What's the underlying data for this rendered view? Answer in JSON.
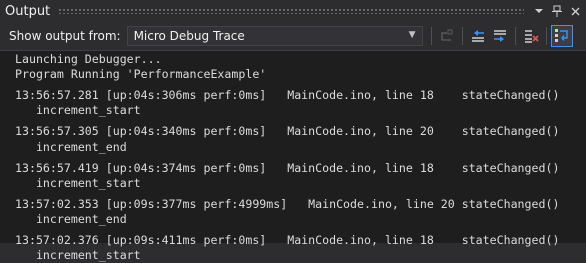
{
  "window": {
    "title": "Output"
  },
  "toolbar": {
    "show_output_label": "Show output from:",
    "source_selected": "Micro Debug Trace"
  },
  "icons": {
    "dropdown": "chevron-down-icon",
    "pin": "pin-icon",
    "close": "close-icon",
    "find_message": "find-message-icon",
    "previous_message": "previous-message-icon",
    "next_message": "next-message-icon",
    "clear_all": "clear-all-icon",
    "word_wrap": "word-wrap-icon"
  },
  "colors": {
    "accent": "#3794ff",
    "clear_red": "#e05252",
    "background": "#1e1e1e",
    "panel": "#2d2d30"
  },
  "output": {
    "header_lines": [
      "Launching Debugger...",
      "Program Running 'PerformanceExample'"
    ],
    "entries": [
      {
        "line": "13:56:57.281 [up:04s:306ms perf:0ms]   MainCode.ino, line 18    stateChanged()",
        "detail": "   increment_start"
      },
      {
        "line": "13:56:57.305 [up:04s:340ms perf:0ms]   MainCode.ino, line 20    stateChanged()",
        "detail": "   increment_end"
      },
      {
        "line": "13:56:57.419 [up:04s:374ms perf:0ms]   MainCode.ino, line 18    stateChanged()",
        "detail": "   increment_start"
      },
      {
        "line": "13:57:02.353 [up:09s:377ms perf:4999ms]   MainCode.ino, line 20 stateChanged()",
        "detail": "   increment_end"
      },
      {
        "line": "13:57:02.376 [up:09s:411ms perf:0ms]   MainCode.ino, line 18    stateChanged()",
        "detail": "   increment_start"
      }
    ]
  }
}
